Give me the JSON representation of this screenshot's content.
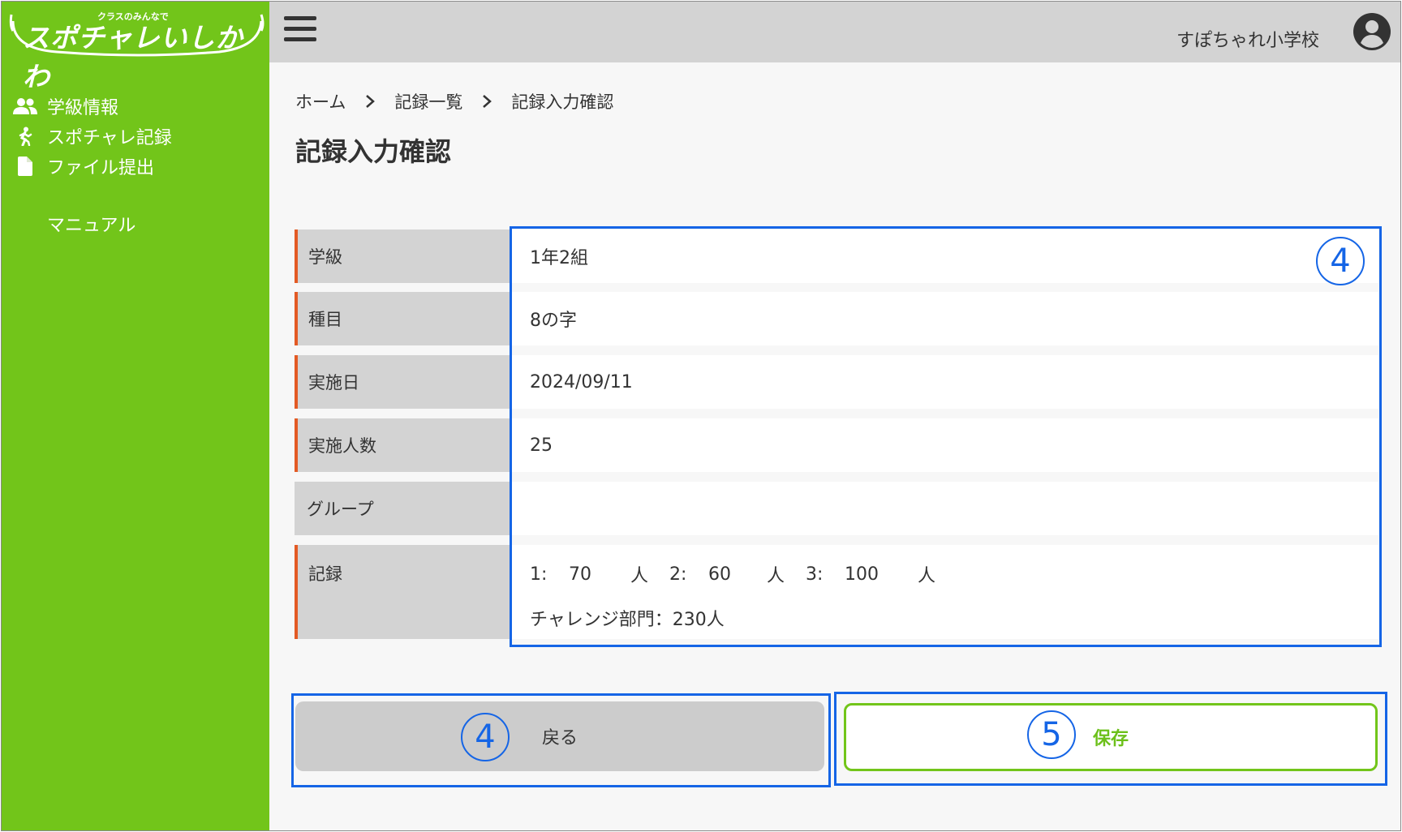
{
  "app": {
    "logo_small": "クラスのみんなで",
    "logo_big": "スポチャレいしかわ"
  },
  "sidebar": {
    "items": [
      {
        "label": "学級情報",
        "icon": "users-icon"
      },
      {
        "label": "スポチャレ記録",
        "icon": "running-icon"
      },
      {
        "label": "ファイル提出",
        "icon": "file-icon"
      }
    ],
    "manual": "マニュアル"
  },
  "header": {
    "school": "すぽちゃれ小学校",
    "menu_icon": "hamburger-icon",
    "avatar_icon": "user-avatar-icon"
  },
  "breadcrumb": [
    "ホーム",
    "記録一覧",
    "記録入力確認"
  ],
  "page_title": "記録入力確認",
  "table": {
    "rows": [
      {
        "label": "学級",
        "value": "1年2組"
      },
      {
        "label": "種目",
        "value": "8の字"
      },
      {
        "label": "実施日",
        "value": "2024/09/11"
      },
      {
        "label": "実施人数",
        "value": "25"
      },
      {
        "label": "グループ",
        "value": ""
      },
      {
        "label": "記録",
        "value": ""
      }
    ],
    "record": {
      "entries": [
        {
          "index": "1:",
          "value": "70",
          "unit": "人"
        },
        {
          "index": "2:",
          "value": "60",
          "unit": "人"
        },
        {
          "index": "3:",
          "value": "100",
          "unit": "人"
        }
      ],
      "summary": "チャレンジ部門：230人"
    }
  },
  "annotations": {
    "table_number": "4",
    "back_number": "4",
    "save_number": "5"
  },
  "buttons": {
    "back": "戻る",
    "save": "保存"
  },
  "colors": {
    "sidebar": "#72c51a",
    "header": "#d3d3d3",
    "required_marker": "#e35a24",
    "annotation": "#1565e6",
    "save_border": "#72c51a"
  }
}
